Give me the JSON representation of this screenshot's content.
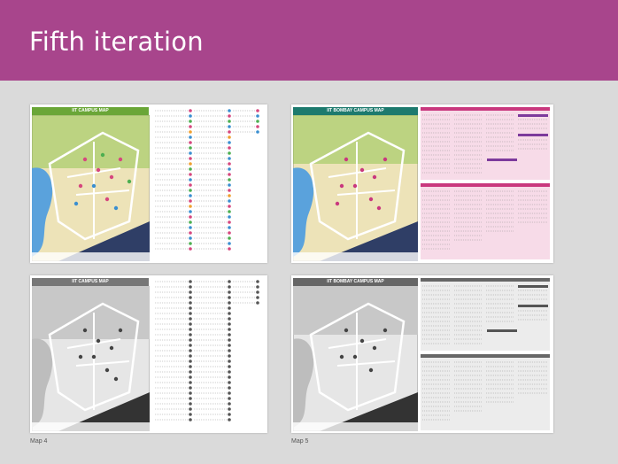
{
  "slide": {
    "title": "Fifth iteration",
    "captions": {
      "left": "Map 4",
      "right": "Map 5"
    }
  },
  "maps": {
    "map4_color_title": "IIT CAMPUS MAP",
    "map4_gray_title": "IIT CAMPUS MAP",
    "map5_color_title": "IIT BOMBAY CAMPUS MAP",
    "map5_gray_title": "IIT BOMBAY CAMPUS MAP"
  },
  "colors": {
    "header": "#a8458c",
    "map4_title_bar": "#6aa637",
    "map5_title_bar": "#1d7a6e",
    "index_pink": "#c9387e",
    "index_purple": "#7d3a9c"
  }
}
